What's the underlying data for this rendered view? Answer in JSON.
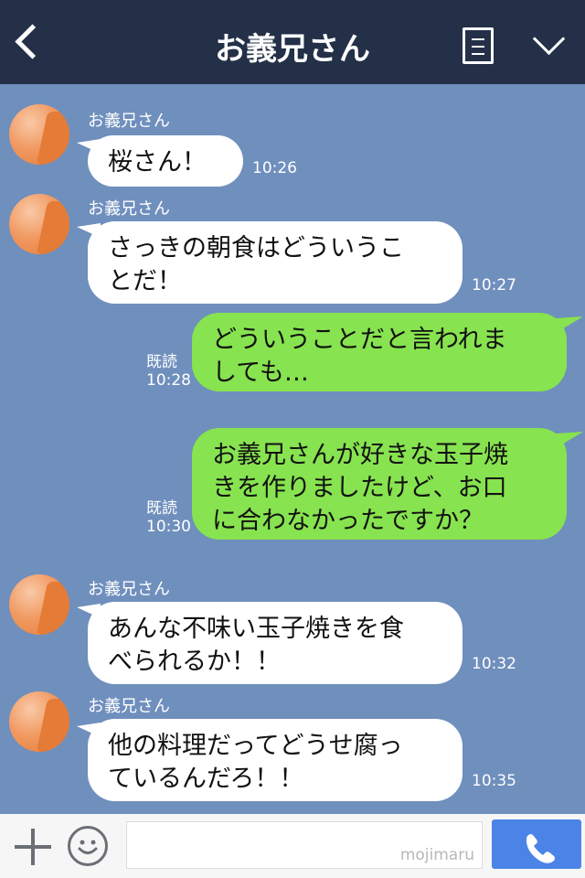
{
  "header": {
    "title": "お義兄さん"
  },
  "messages": [
    {
      "sender": "お義兄さん",
      "text": "桜さん！",
      "time": "10:26"
    },
    {
      "sender": "お義兄さん",
      "line1": "さっきの朝食はどういうこ",
      "line2": "とだ！",
      "time": "10:27"
    },
    {
      "line1": "どういうことだと言われま",
      "line2": "しても…",
      "read": "既読",
      "time": "10:28"
    },
    {
      "line1": "お義兄さんが好きな玉子焼",
      "line2": "きを作りましたけど、お口",
      "line3": "に合わなかったですか？",
      "read": "既読",
      "time": "10:30"
    },
    {
      "sender": "お義兄さん",
      "line1": "あんな不味い玉子焼きを食",
      "line2": "べられるか！！",
      "time": "10:32"
    },
    {
      "sender": "お義兄さん",
      "line1": "他の料理だってどうせ腐っ",
      "line2": "ているんだろ！！",
      "time": "10:35"
    }
  ],
  "input": {
    "watermark": "mojimaru"
  },
  "colors": {
    "header_bg": "#243048",
    "chat_bg": "#6f8fbd",
    "outgoing_bubble": "#87e34f",
    "send_button": "#4b84e6"
  }
}
